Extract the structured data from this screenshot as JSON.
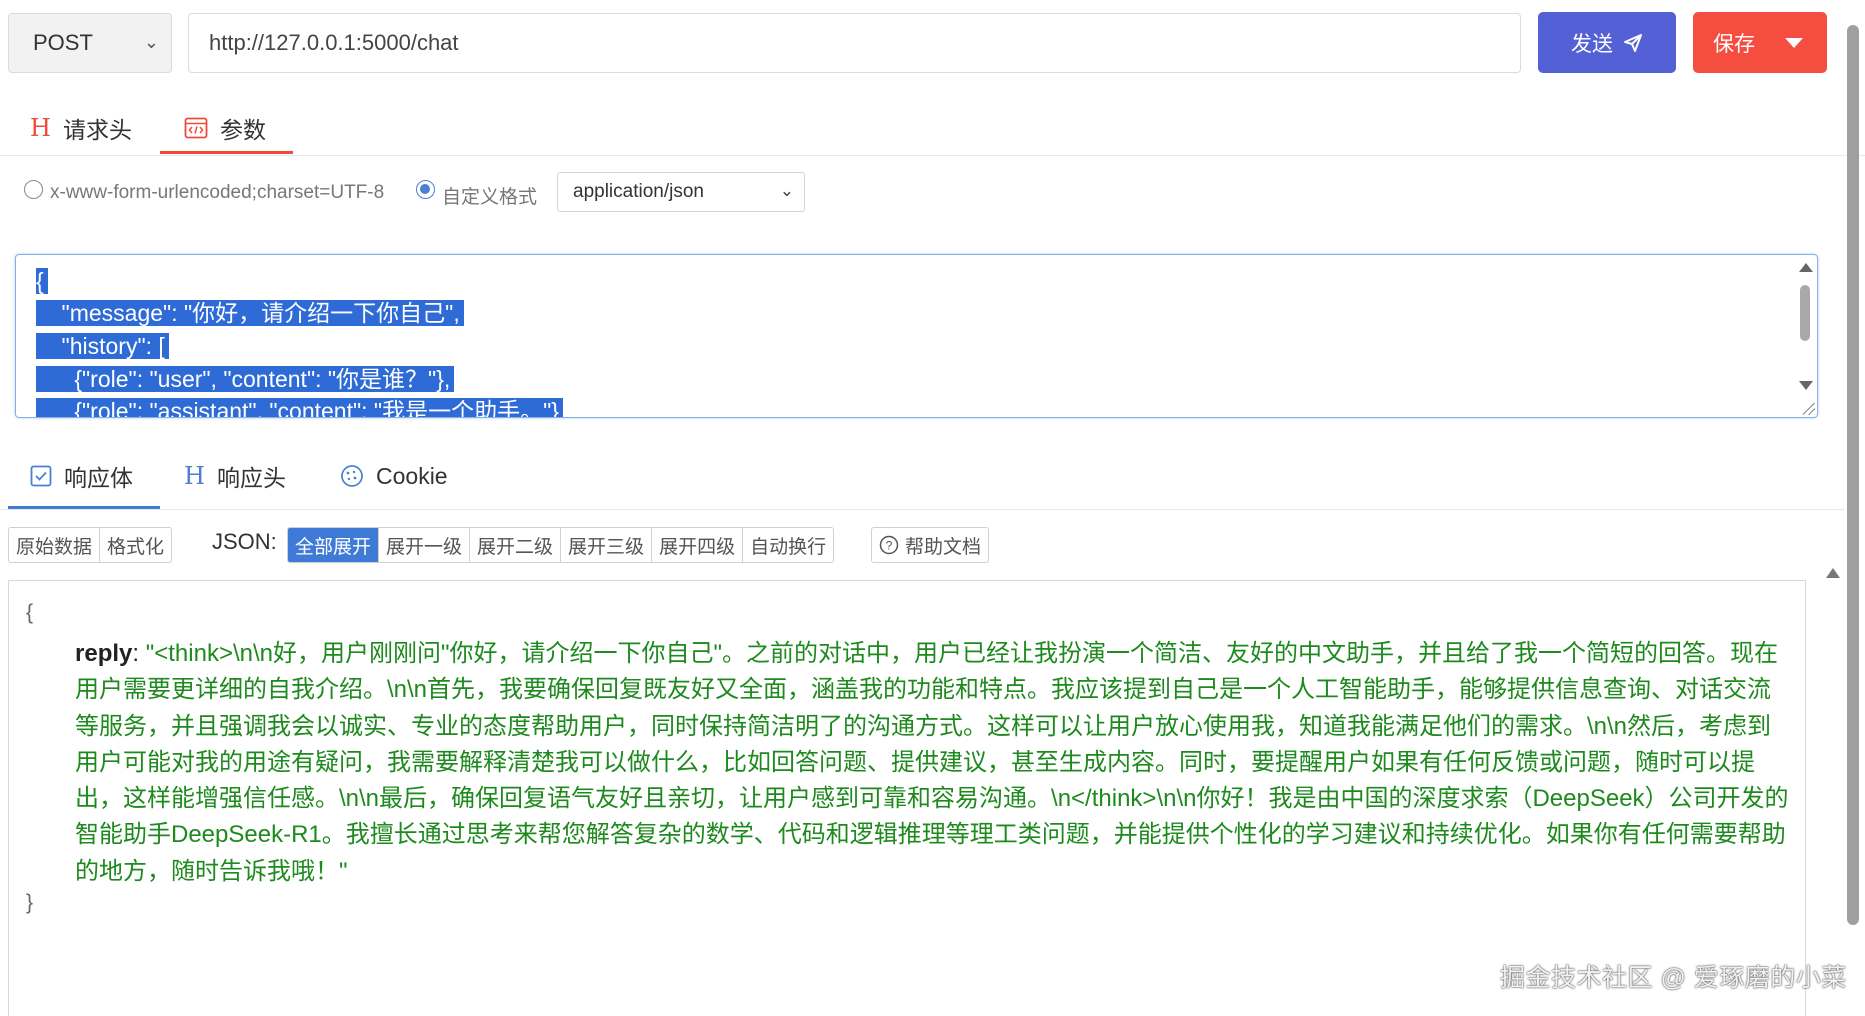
{
  "request": {
    "method": "POST",
    "url": "http://127.0.0.1:5000/chat",
    "send_label": "发送",
    "save_label": "保存"
  },
  "request_tabs": [
    {
      "label": "请求头",
      "icon": "H"
    },
    {
      "label": "参数",
      "icon": "code-window-icon"
    }
  ],
  "format": {
    "option1": "x-www-form-urlencoded;charset=UTF-8",
    "option2": "自定义格式",
    "selected_option": "自定义格式",
    "content_type": "application/json"
  },
  "body_lines": [
    "{",
    "    \"message\": \"你好，请介绍一下你自己\",",
    "    \"history\": [",
    "      {\"role\": \"user\", \"content\": \"你是谁？\"},",
    "      {\"role\": \"assistant\", \"content\": \"我是一个助手。\"}"
  ],
  "response_tabs": [
    {
      "label": "响应体"
    },
    {
      "label": "响应头"
    },
    {
      "label": "Cookie"
    }
  ],
  "view_buttons": [
    "原始数据",
    "格式化"
  ],
  "json_label": "JSON:",
  "expand_buttons": [
    "全部展开",
    "展开一级",
    "展开二级",
    "展开三级",
    "展开四级",
    "自动换行"
  ],
  "active_expand": "全部展开",
  "help_label": "帮助文档",
  "response": {
    "open_brace": "{",
    "key": "reply",
    "value": "\"<think>\\n\\n好，用户刚刚问\"你好，请介绍一下你自己\"。之前的对话中，用户已经让我扮演一个简洁、友好的中文助手，并且给了我一个简短的回答。现在用户需要更详细的自我介绍。\\n\\n首先，我要确保回复既友好又全面，涵盖我的功能和特点。我应该提到自己是一个人工智能助手，能够提供信息查询、对话交流等服务，并且强调我会以诚实、专业的态度帮助用户，同时保持简洁明了的沟通方式。这样可以让用户放心使用我，知道我能满足他们的需求。\\n\\n然后，考虑到用户可能对我的用途有疑问，我需要解释清楚我可以做什么，比如回答问题、提供建议，甚至生成内容。同时，要提醒用户如果有任何反馈或问题，随时可以提出，这样能增强信任感。\\n\\n最后，确保回复语气友好且亲切，让用户感到可靠和容易沟通。\\n</think>\\n\\n你好！我是由中国的深度求索（DeepSeek）公司开发的智能助手DeepSeek-R1。我擅长通过思考来帮您解答复杂的数学、代码和逻辑推理等理工类问题，并能提供个性化的学习建议和持续优化。如果你有任何需要帮助的地方，随时告诉我哦！\"",
    "close_brace": "}"
  },
  "watermark": "掘金技术社区 @ 爱琢磨的小菜",
  "colors": {
    "send": "#5460d6",
    "save": "#f54d3f",
    "accent_red": "#ef4b3b",
    "accent_blue": "#3f7bd6",
    "selection": "#2e6bd6",
    "json_value": "#1e8a1e"
  }
}
